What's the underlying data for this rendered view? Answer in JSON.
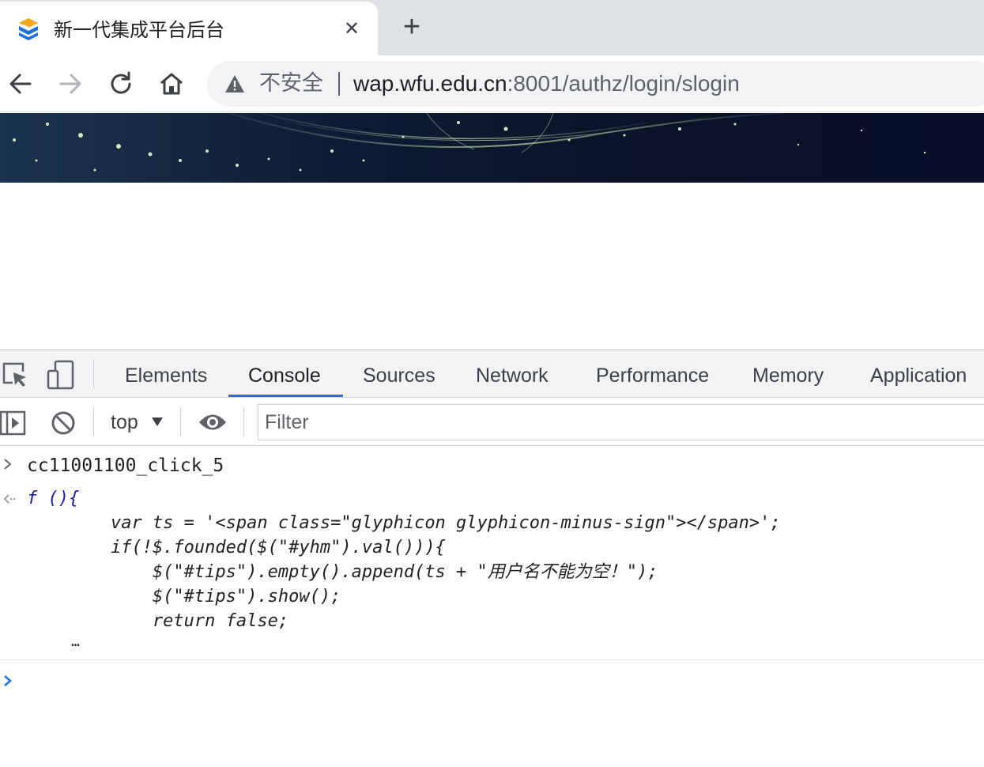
{
  "browser": {
    "tab": {
      "title": "新一代集成平台后台",
      "favicon": "site-logo-icon",
      "close_glyph": "✕"
    },
    "new_tab_glyph": "+",
    "nav": {
      "back": "arrow-left-icon",
      "forward": "arrow-right-icon",
      "reload": "reload-icon",
      "home": "home-icon"
    },
    "omnibox": {
      "security_label": "不安全",
      "host": "wap.wfu.edu.cn",
      "rest": ":8001/authz/login/slogin"
    }
  },
  "devtools": {
    "tabs": [
      "Elements",
      "Console",
      "Sources",
      "Network",
      "Performance",
      "Memory",
      "Application"
    ],
    "active_tab": "Console",
    "console": {
      "context": "top",
      "filter_placeholder": "Filter",
      "entries": {
        "command": "cc11001100_click_5",
        "result_lines": [
          "f (){",
          "        var ts = '<span class=\"glyphicon glyphicon-minus-sign\"></span>';",
          "        if(!$.founded($(\"#yhm\").val())){",
          "            $(\"#tips\").empty().append(ts + \"用户名不能为空！\");",
          "            $(\"#tips\").show();",
          "            return false;"
        ],
        "truncated": "…"
      }
    }
  },
  "colors": {
    "accent": "#1a73e8",
    "tab_strip": "#dee1e6",
    "omnibox": "#f1f3f4",
    "banner": "#0a1328"
  }
}
